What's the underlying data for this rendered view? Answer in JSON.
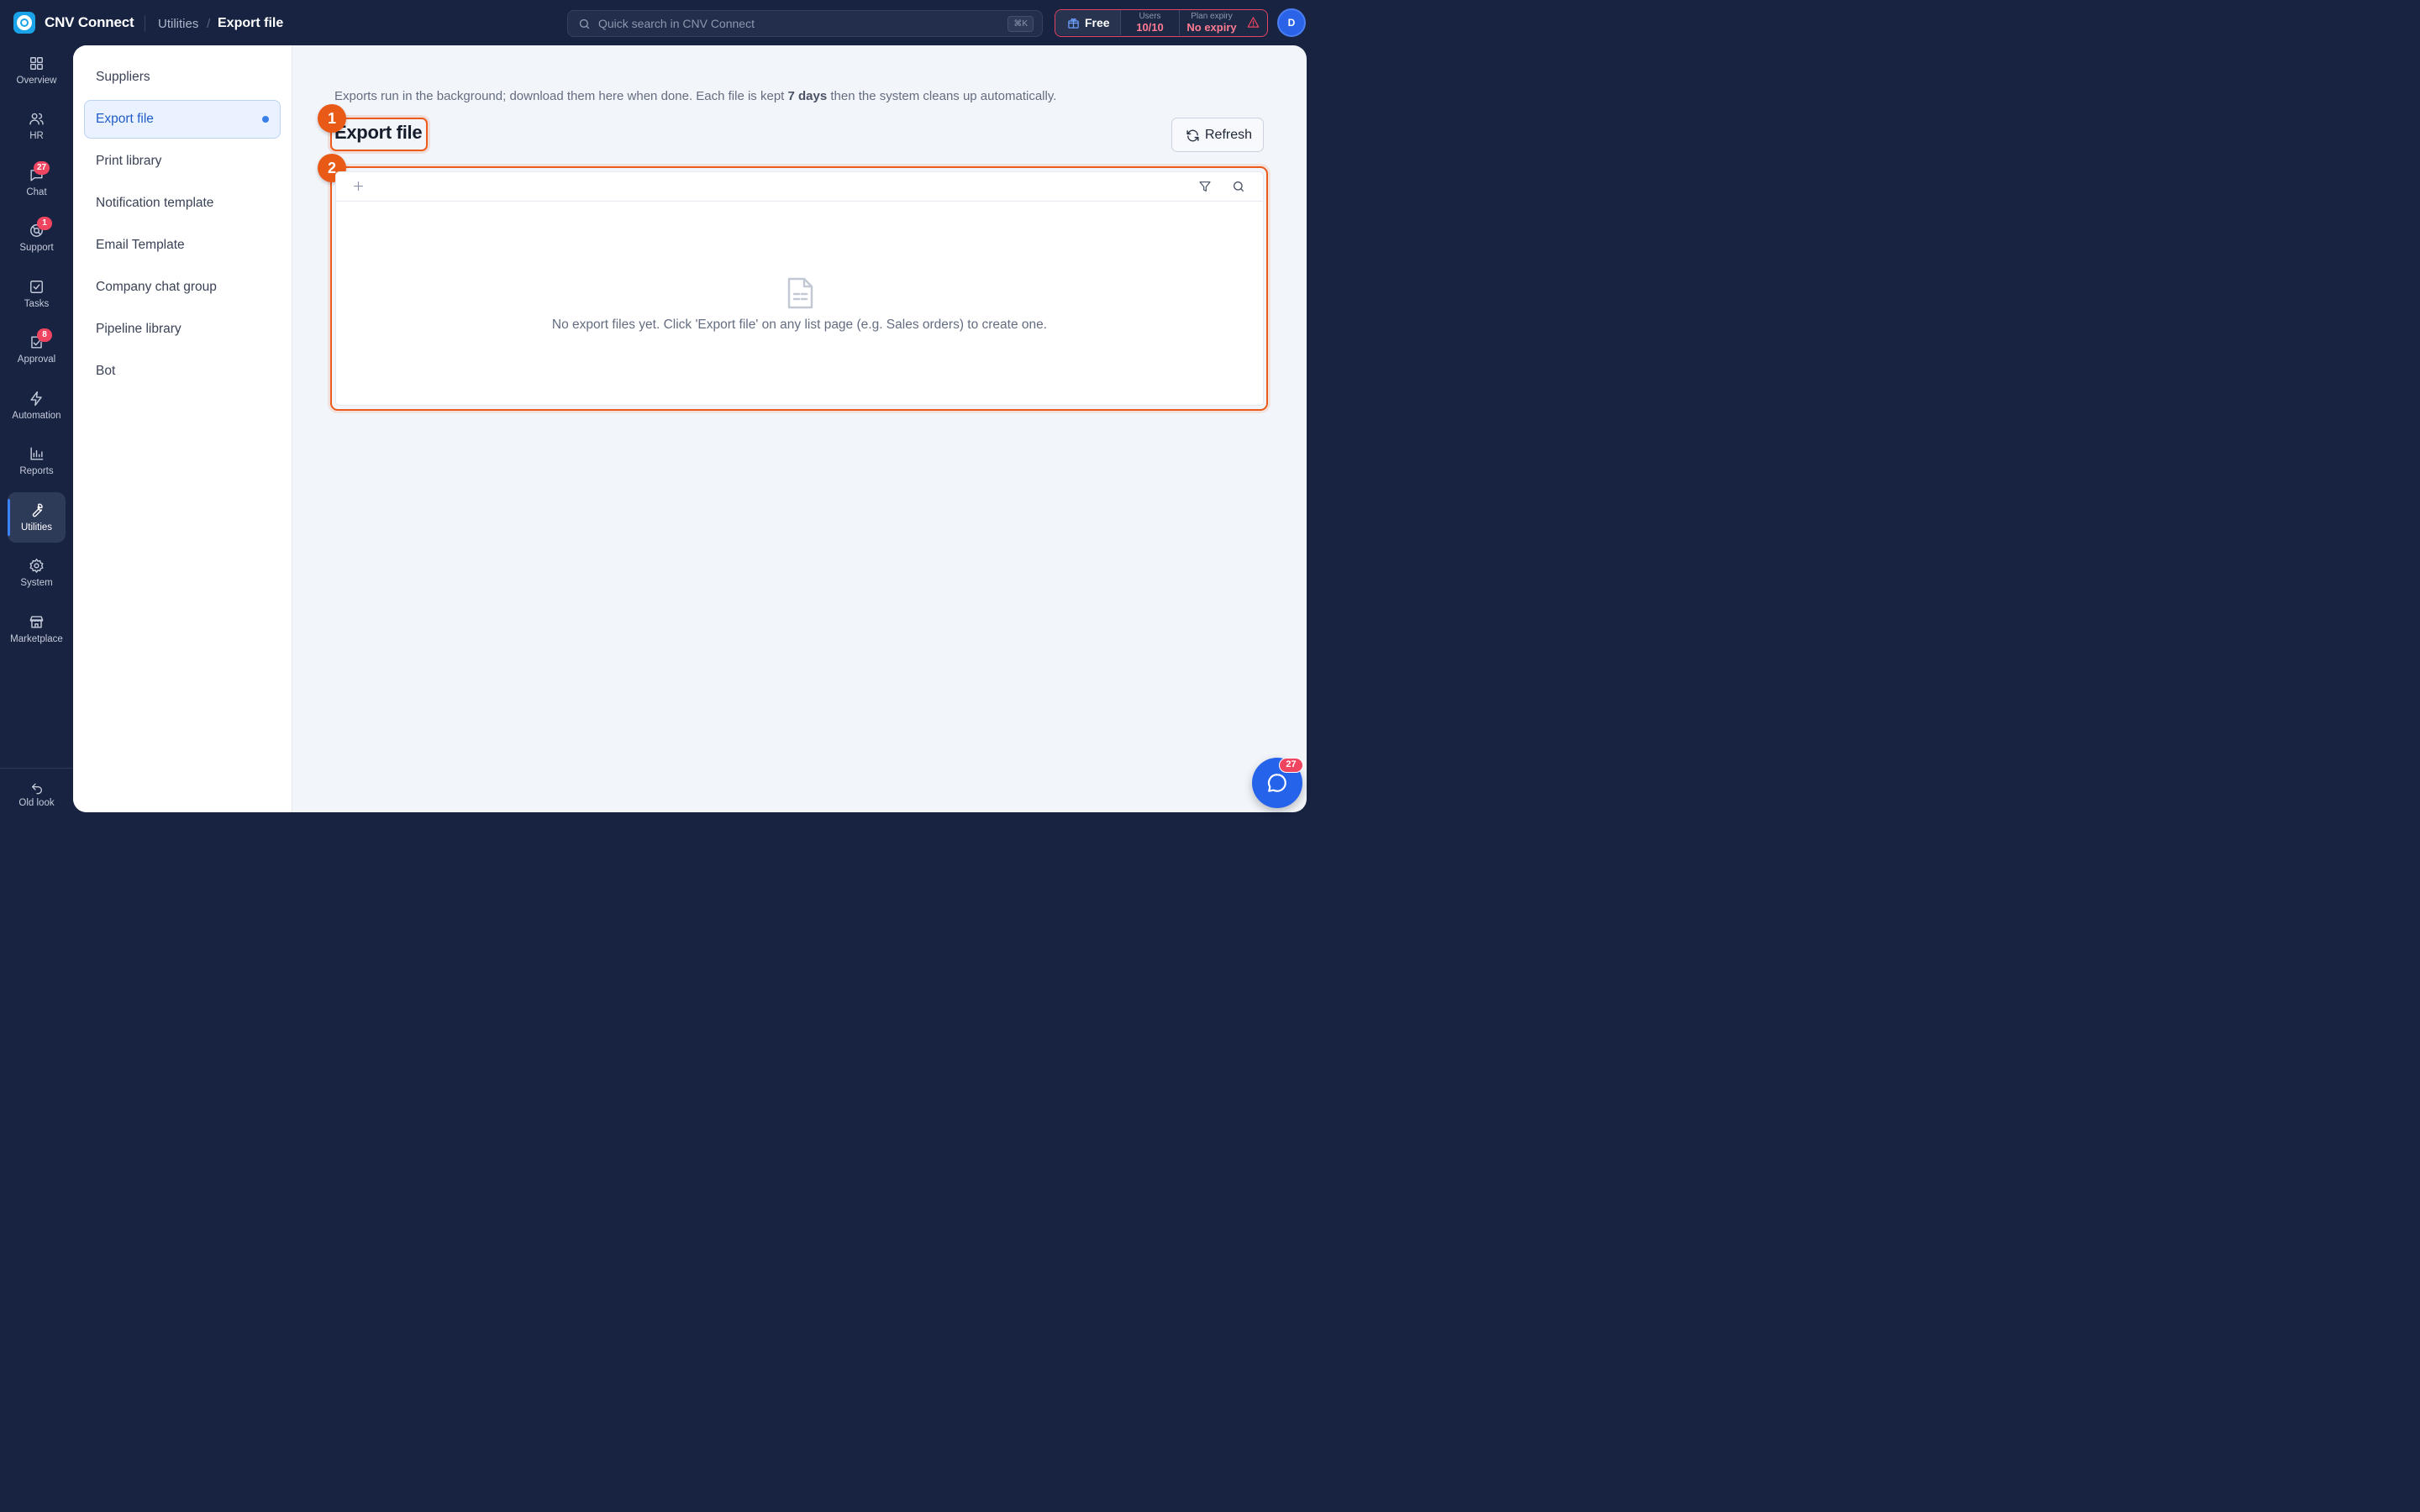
{
  "app": {
    "name": "CNV Connect"
  },
  "breadcrumb": {
    "parent": "Utilities",
    "separator": "/",
    "current": "Export file"
  },
  "search": {
    "placeholder": "Quick search in CNV Connect",
    "shortcut": "⌘K"
  },
  "plan": {
    "tier": "Free",
    "users_label": "Users",
    "users_value": "10/10",
    "expiry_label": "Plan expiry",
    "expiry_value": "No expiry",
    "alert_color": "#e44463"
  },
  "user": {
    "initial": "D"
  },
  "rail": {
    "items": [
      {
        "label": "Overview",
        "icon": "grid-icon"
      },
      {
        "label": "HR",
        "icon": "users-icon"
      },
      {
        "label": "Chat",
        "icon": "chat-icon",
        "badge": "27"
      },
      {
        "label": "Support",
        "icon": "lifebuoy-icon",
        "badge": "1"
      },
      {
        "label": "Tasks",
        "icon": "checkbox-icon"
      },
      {
        "label": "Approval",
        "icon": "approval-icon",
        "badge": "8"
      },
      {
        "label": "Automation",
        "icon": "lightning-icon"
      },
      {
        "label": "Reports",
        "icon": "bar-chart-icon"
      },
      {
        "label": "Utilities",
        "icon": "wrench-icon",
        "active": true
      },
      {
        "label": "System",
        "icon": "gear-icon"
      },
      {
        "label": "Marketplace",
        "icon": "store-icon"
      }
    ],
    "bottom": {
      "label": "Old look",
      "icon": "undo-icon"
    }
  },
  "subnav": {
    "items": [
      {
        "label": "Suppliers"
      },
      {
        "label": "Export file",
        "active": true
      },
      {
        "label": "Print library"
      },
      {
        "label": "Notification template"
      },
      {
        "label": "Email Template"
      },
      {
        "label": "Company chat group"
      },
      {
        "label": "Pipeline library"
      },
      {
        "label": "Bot"
      }
    ]
  },
  "main": {
    "intro_before": "Exports run in the background; download them here when done. Each file is kept ",
    "intro_bold": "7 days",
    "intro_after": " then the system cleans up automatically.",
    "title": "Export file",
    "refresh_label": "Refresh",
    "empty_text": "No export files yet. Click 'Export file' on any list page (e.g. Sales orders) to create one.",
    "markers": [
      "1",
      "2"
    ]
  },
  "chat_fab": {
    "badge": "27"
  },
  "colors": {
    "accent": "#2563eb",
    "highlight": "#ec5a1c",
    "badge": "#ef4560",
    "rail_bg": "#172340"
  }
}
